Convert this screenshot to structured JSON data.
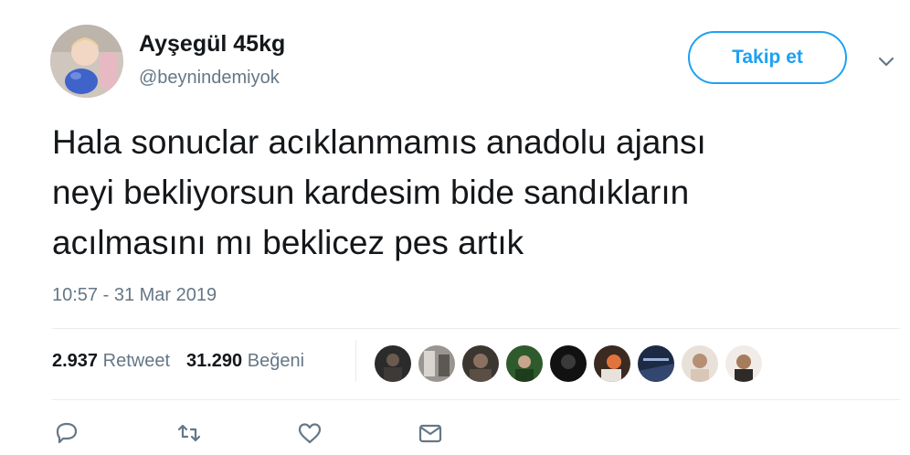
{
  "author": {
    "name": "Ayşegül 45kg",
    "handle": "@beynindemiyok"
  },
  "follow_button": {
    "label": "Takip et"
  },
  "tweet": {
    "text": "Hala sonuclar acıklanmamıs anadolu ajansı\nneyi bekliyorsun kardesim bide sandıkların\nacılmasını mı beklicez pes artık",
    "timestamp": "10:57 - 31 Mar 2019"
  },
  "stats": {
    "retweet_count": "2.937",
    "retweet_label": "Retweet",
    "like_count": "31.290",
    "like_label": "Beğeni"
  },
  "colors": {
    "accent": "#1da1f2",
    "secondary_text": "#657786",
    "divider": "#e6ecf0"
  },
  "icons": {
    "reply": "reply-icon",
    "retweet": "retweet-icon",
    "like": "heart-icon",
    "message": "message-icon",
    "more": "chevron-down-icon"
  }
}
